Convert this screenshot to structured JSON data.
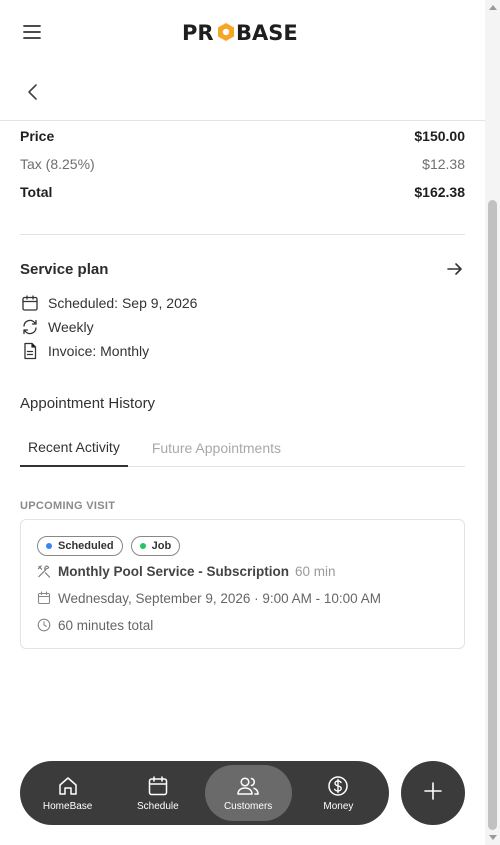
{
  "app": {
    "brand": "PROBASE"
  },
  "pricing": {
    "price_label": "Price",
    "price_value": "$150.00",
    "tax_label": "Tax (8.25%)",
    "tax_value": "$12.38",
    "total_label": "Total",
    "total_value": "$162.38"
  },
  "service_plan": {
    "title": "Service plan",
    "scheduled": "Scheduled: Sep 9, 2026",
    "frequency": "Weekly",
    "invoice": "Invoice: Monthly"
  },
  "history": {
    "title": "Appointment History",
    "tabs": [
      {
        "label": "Recent Activity",
        "active": true
      },
      {
        "label": "Future Appointments",
        "active": false
      }
    ],
    "upcoming_label": "UPCOMING VISIT",
    "visit": {
      "badges": [
        {
          "label": "Scheduled",
          "color": "#3b82f6"
        },
        {
          "label": "Job",
          "color": "#22c55e"
        }
      ],
      "job_title": "Monthly Pool Service - Subscription",
      "job_duration": "60 min",
      "datetime": "Wednesday, September 9, 2026 · 9:00 AM - 10:00 AM",
      "total_time": "60 minutes total"
    }
  },
  "nav": {
    "items": [
      {
        "label": "HomeBase",
        "icon": "home-icon",
        "active": false
      },
      {
        "label": "Schedule",
        "icon": "calendar-icon",
        "active": false
      },
      {
        "label": "Customers",
        "icon": "users-icon",
        "active": true
      },
      {
        "label": "Money",
        "icon": "dollar-icon",
        "active": false
      }
    ],
    "fab_icon": "plus-icon"
  },
  "colors": {
    "nav_bg": "#3b3b3b",
    "nav_active": "#6a6a6a",
    "logo_hex": "#f5a623"
  }
}
